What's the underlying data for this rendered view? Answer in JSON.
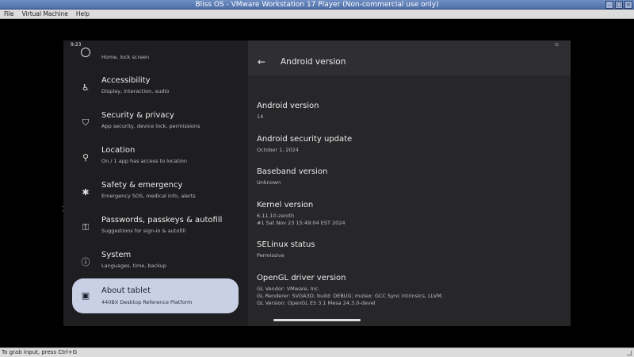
{
  "window": {
    "title": "Bliss OS - VMware Workstation 17 Player (Non-commercial use only)"
  },
  "menu": [
    "File",
    "Virtual Machine",
    "Help"
  ],
  "status": {
    "hint": "To grab input, press Ctrl+G",
    "time": "9:23",
    "right": "⊙"
  },
  "settings": {
    "partial_sub": "Home, lock screen",
    "items": [
      {
        "label": "Accessibility",
        "sub": "Display, interaction, audio",
        "icon": "accessibility-icon",
        "glyph": "♿"
      },
      {
        "label": "Security & privacy",
        "sub": "App security, device lock, permissions",
        "icon": "shield-icon",
        "glyph": "⛉"
      },
      {
        "label": "Location",
        "sub": "On / 1 app has access to location",
        "icon": "location-pin-icon",
        "glyph": "⚲"
      },
      {
        "label": "Safety & emergency",
        "sub": "Emergency SOS, medical info, alerts",
        "icon": "asterisk-icon",
        "glyph": "✱"
      },
      {
        "label": "Passwords, passkeys & autofill",
        "sub": "Suggestions for sign-in & autofill",
        "icon": "key-icon",
        "glyph": "⚿"
      },
      {
        "label": "System",
        "sub": "Languages, time, backup",
        "icon": "info-icon",
        "glyph": "ⓘ"
      },
      {
        "label": "About tablet",
        "sub": "440BX Desktop Reference Platform",
        "icon": "tablet-icon",
        "glyph": "▣"
      }
    ]
  },
  "detail": {
    "title": "Android version",
    "entries": [
      {
        "title": "Android version",
        "value": "14"
      },
      {
        "title": "Android security update",
        "value": "October 1, 2024"
      },
      {
        "title": "Baseband version",
        "value": "Unknown"
      },
      {
        "title": "Kernel version",
        "value": "6.11.10-zenith\n#1 Sat Nov 23 15:49:04 EST 2024"
      },
      {
        "title": "SELinux status",
        "value": "Permissive"
      },
      {
        "title": "OpenGL driver version",
        "value": "GL Vendor: VMware, Inc.\nGL Renderer: SVGA3D; build: DEBUG; mutex: GCC Sync intrinsics, LLVM;\nGL Version: OpenGL ES 3.1 Mesa 24.3.0-devel"
      }
    ]
  },
  "colors": {
    "selected_bg": "#c9d0e6",
    "pane_bg": "#1e1e21",
    "detail_bg": "#27272a"
  }
}
